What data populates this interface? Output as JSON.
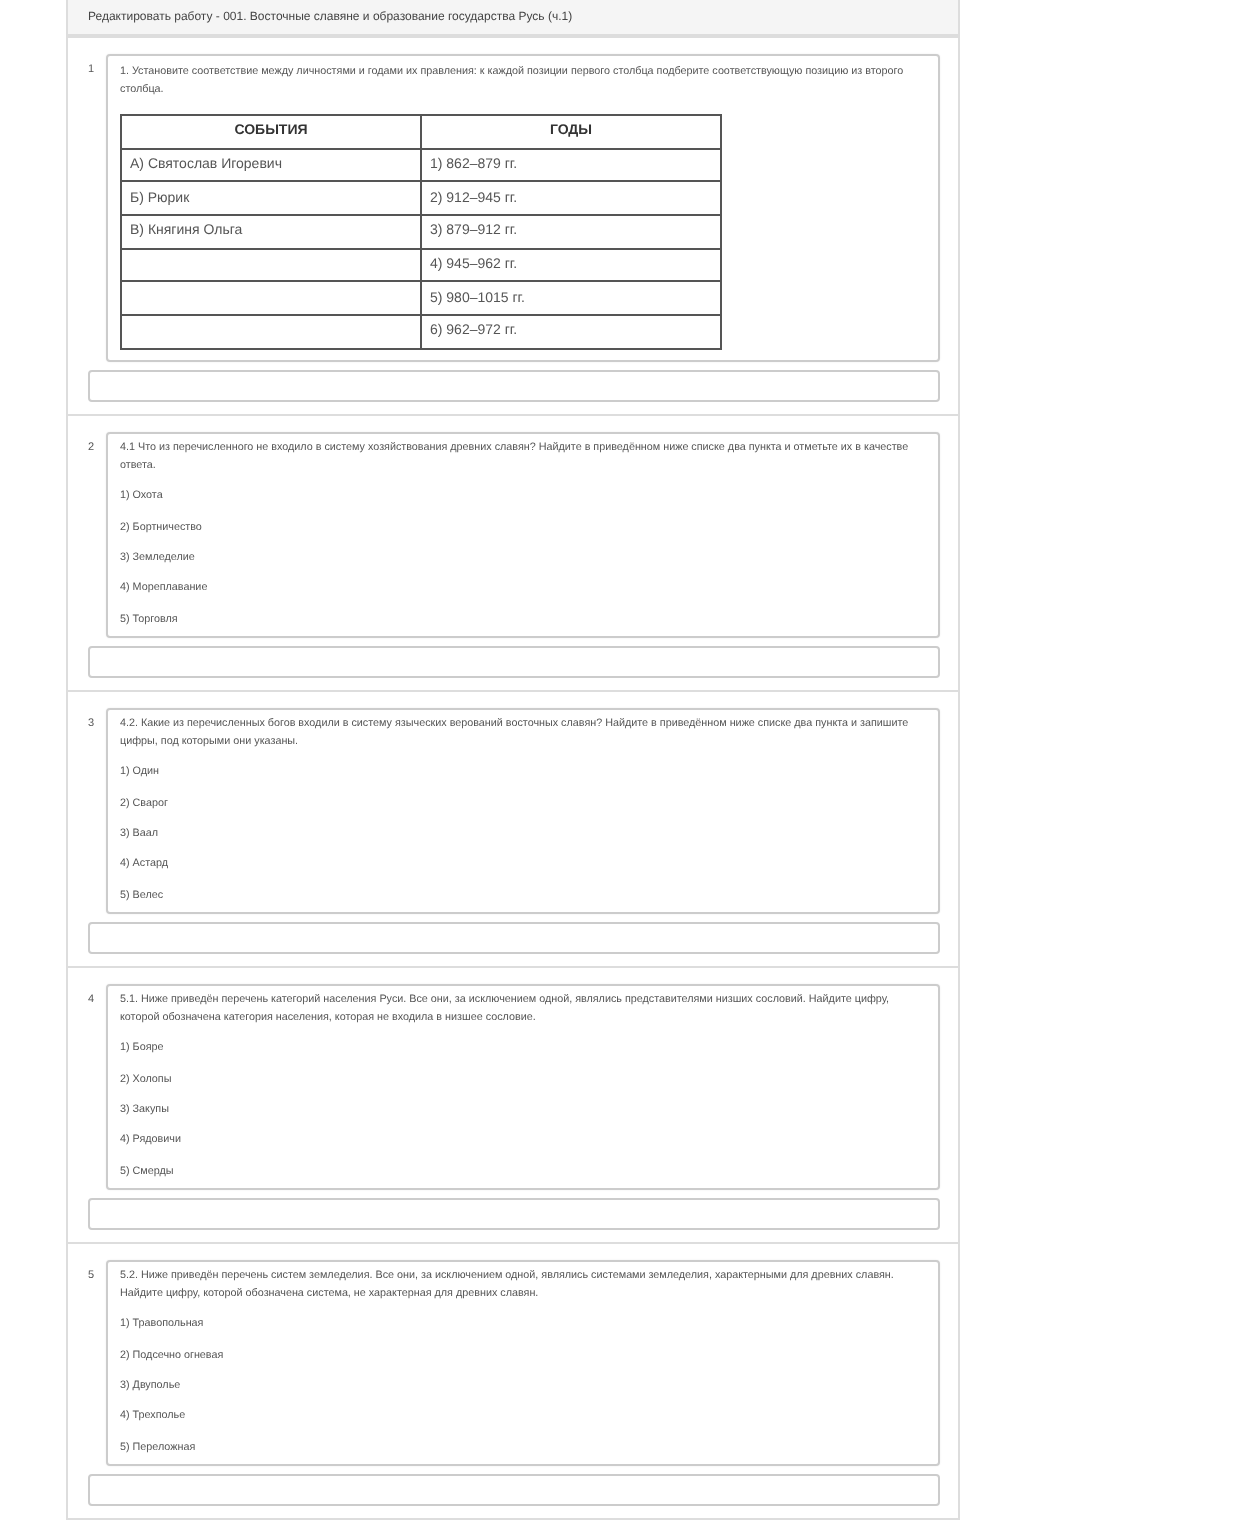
{
  "header": {
    "title": "Редактировать работу - 001. Восточные славяне и образование государства Русь (ч.1)"
  },
  "questions": [
    {
      "number": "1",
      "kind": "matching",
      "text": "1. Установите соответствие между личностями и годами их правления: к каждой позиции первого столбца подберите соответствующую позицию из второго столбца.",
      "columns": [
        {
          "heading": "СОБЫТИЯ",
          "items": [
            "А) Святослав Игоревич",
            "Б) Рюрик",
            "В) Княгиня Ольга"
          ]
        },
        {
          "heading": "ГОДЫ",
          "items": [
            "1) 862–879 гг.",
            "2) 912–945 гг.",
            "3) 879–912 гг.",
            "4) 945–962 гг.",
            "5) 980–1015 гг.",
            "6) 962–972 гг."
          ]
        }
      ]
    },
    {
      "number": "2",
      "kind": "choice",
      "text": "4.1 Что из перечисленного не входило в систему хозяйствования древних славян? Найдите в приведённом ниже списке два пункта и отметьте их в качестве ответа.",
      "options": [
        "1) Охота",
        "2) Бортничество",
        "3) Земледелие",
        "4) Мореплавание",
        "5) Торговля"
      ]
    },
    {
      "number": "3",
      "kind": "choice",
      "text": "4.2. Какие из перечисленных богов входили в систему языческих верований восточных славян? Найдите в приведённом ниже списке два пункта и запишите цифры, под которыми они указаны.",
      "options": [
        "1) Один",
        "2) Сварог",
        "3) Ваал",
        "4) Астард",
        "5) Велес"
      ]
    },
    {
      "number": "4",
      "kind": "choice",
      "text": "5.1. Ниже приведён перечень категорий населения Руси. Все они, за исключением одной, являлись представителями низших сословий. Найдите цифру, которой обозначена категория населения, которая не входила в низшее сословие.",
      "options": [
        "1) Бояре",
        "2) Холопы",
        "3) Закупы",
        "4) Рядовичи",
        "5) Смерды"
      ]
    },
    {
      "number": "5",
      "kind": "choice",
      "text": "5.2. Ниже приведён перечень систем земледелия. Все они, за исключением одной, являлись системами земледелия, характерными для древних славян. Найдите цифру, которой обозначена система, не характерная для древних славян.",
      "options": [
        "1) Травопольная",
        "2) Подсечно огневая",
        "3) Двуполье",
        "4) Трехполье",
        "5) Переложная"
      ]
    }
  ]
}
